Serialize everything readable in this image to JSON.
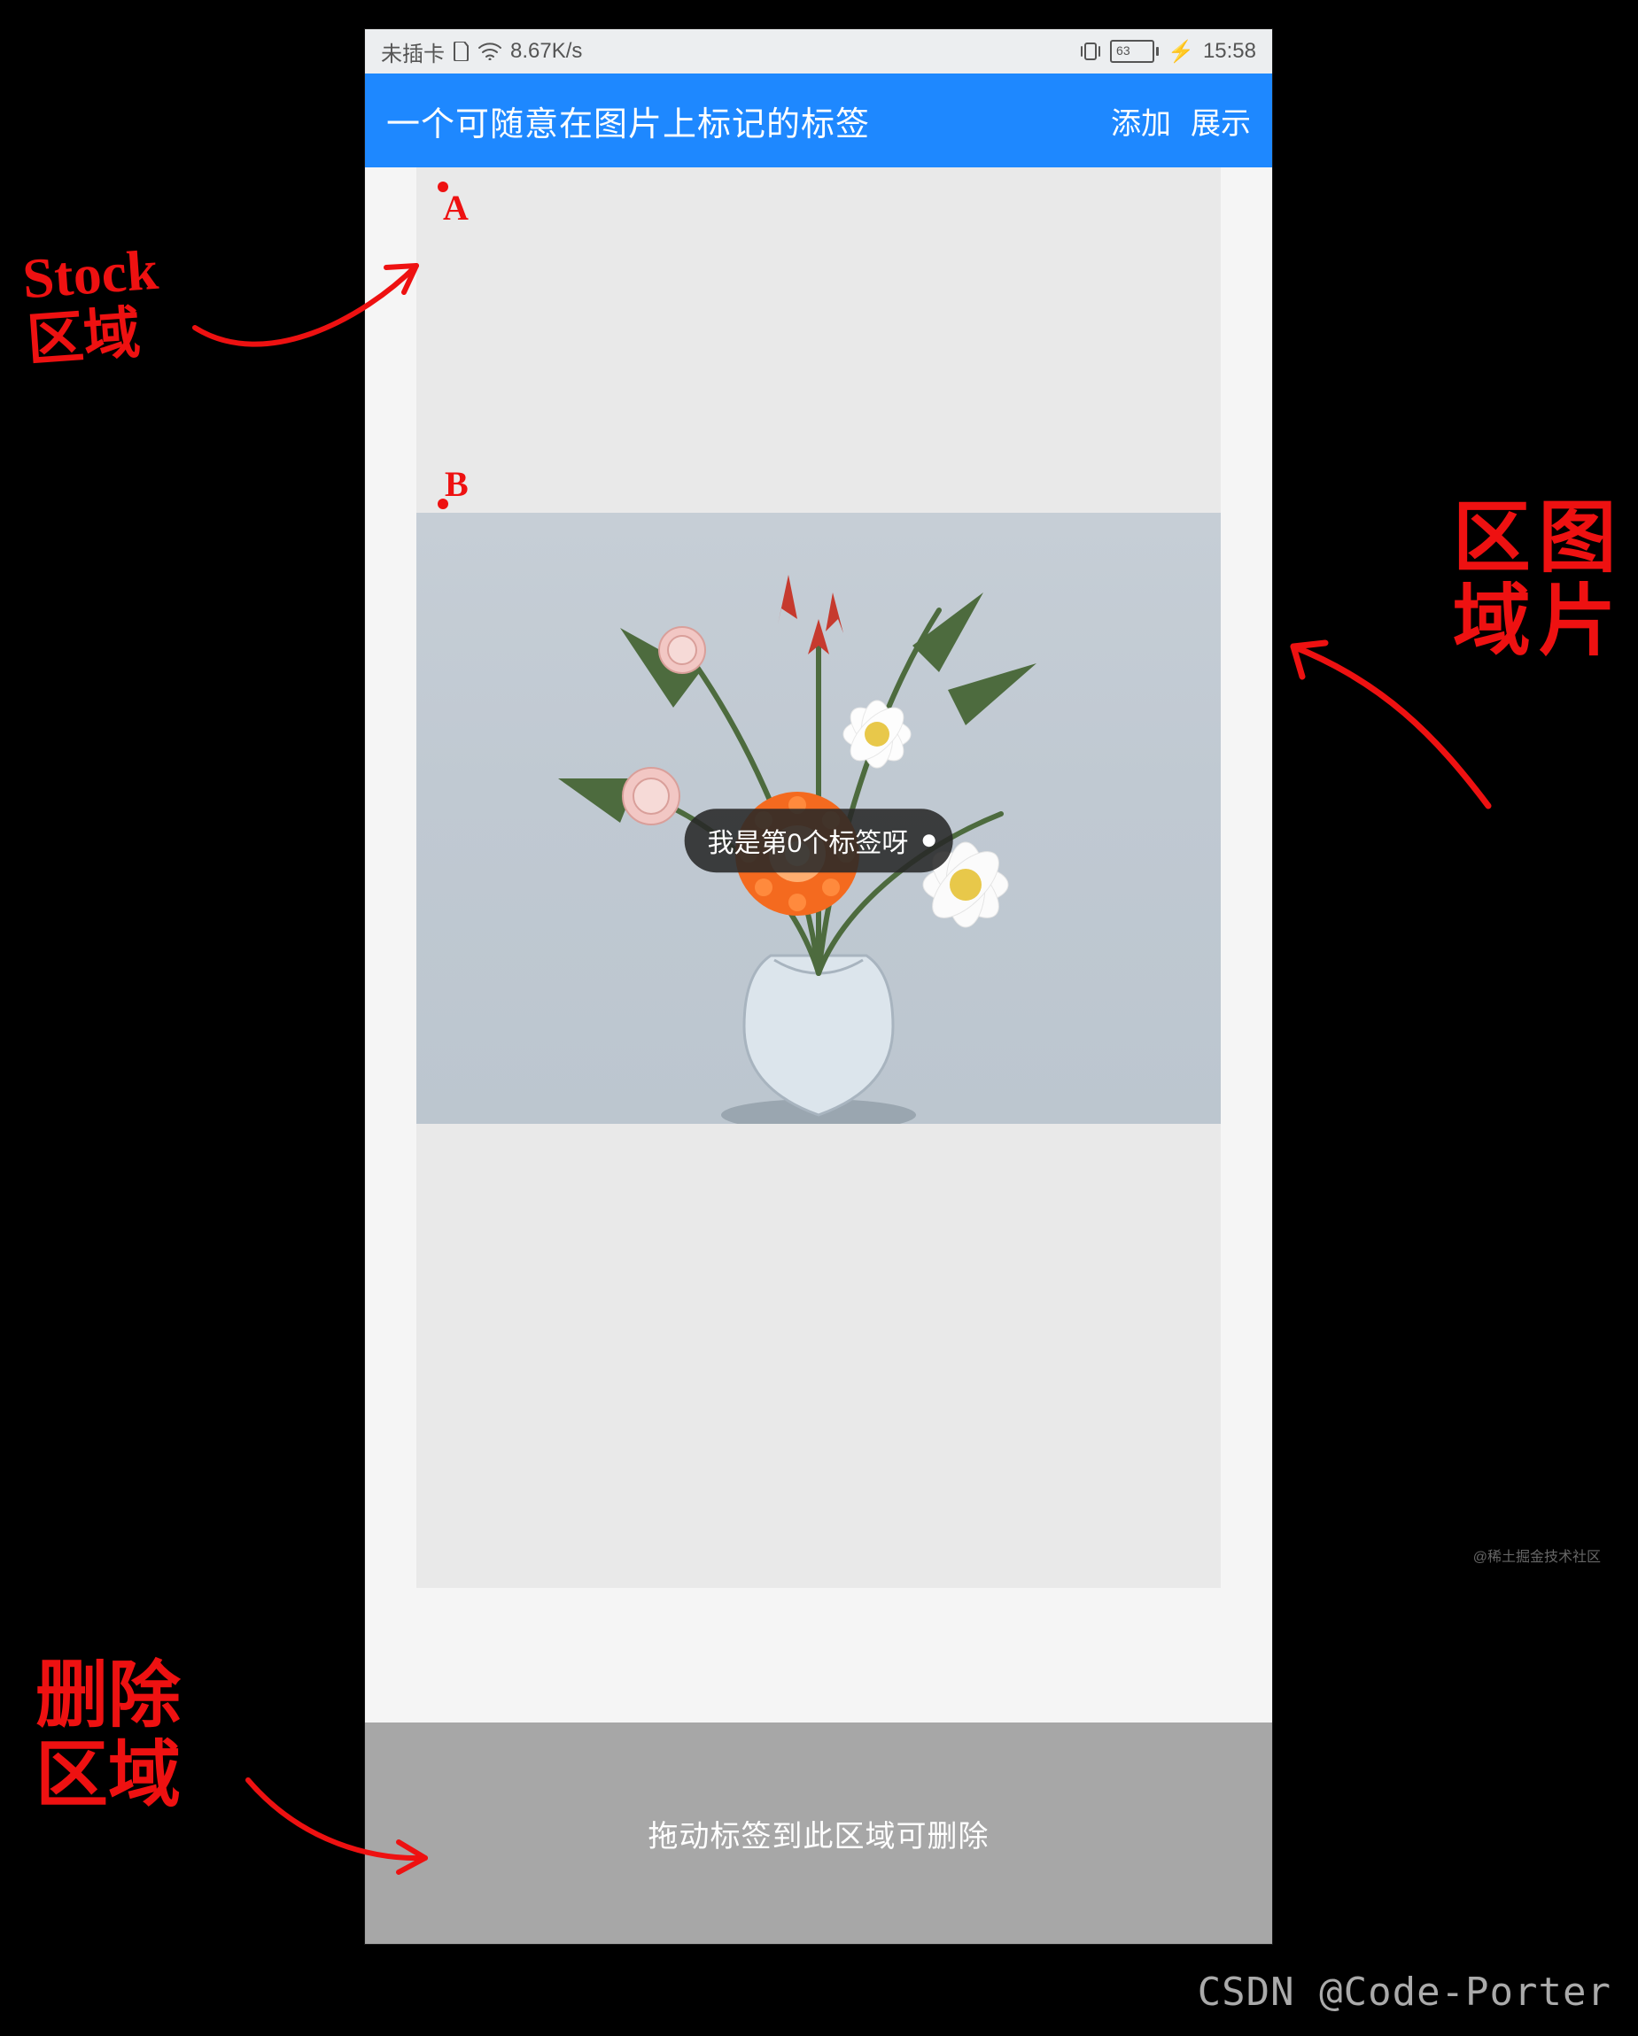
{
  "statusbar": {
    "sim": "未插卡",
    "speed": "8.67K/s",
    "battery": "63",
    "charging": "⚡",
    "time": "15:58"
  },
  "titlebar": {
    "title": "一个可随意在图片上标记的标签",
    "add": "添加",
    "show": "展示"
  },
  "markers": {
    "a": "A",
    "b": "B"
  },
  "tag": {
    "text": "我是第0个标签呀"
  },
  "delete": {
    "hint": "拖动标签到此区域可删除"
  },
  "annotations": {
    "stock": "Stock\n区域",
    "image": "图片\n区域",
    "delete": "删除\n区域"
  },
  "watermarks": {
    "juejin": "@稀土掘金技术社区",
    "csdn": "CSDN @Code-Porter"
  }
}
